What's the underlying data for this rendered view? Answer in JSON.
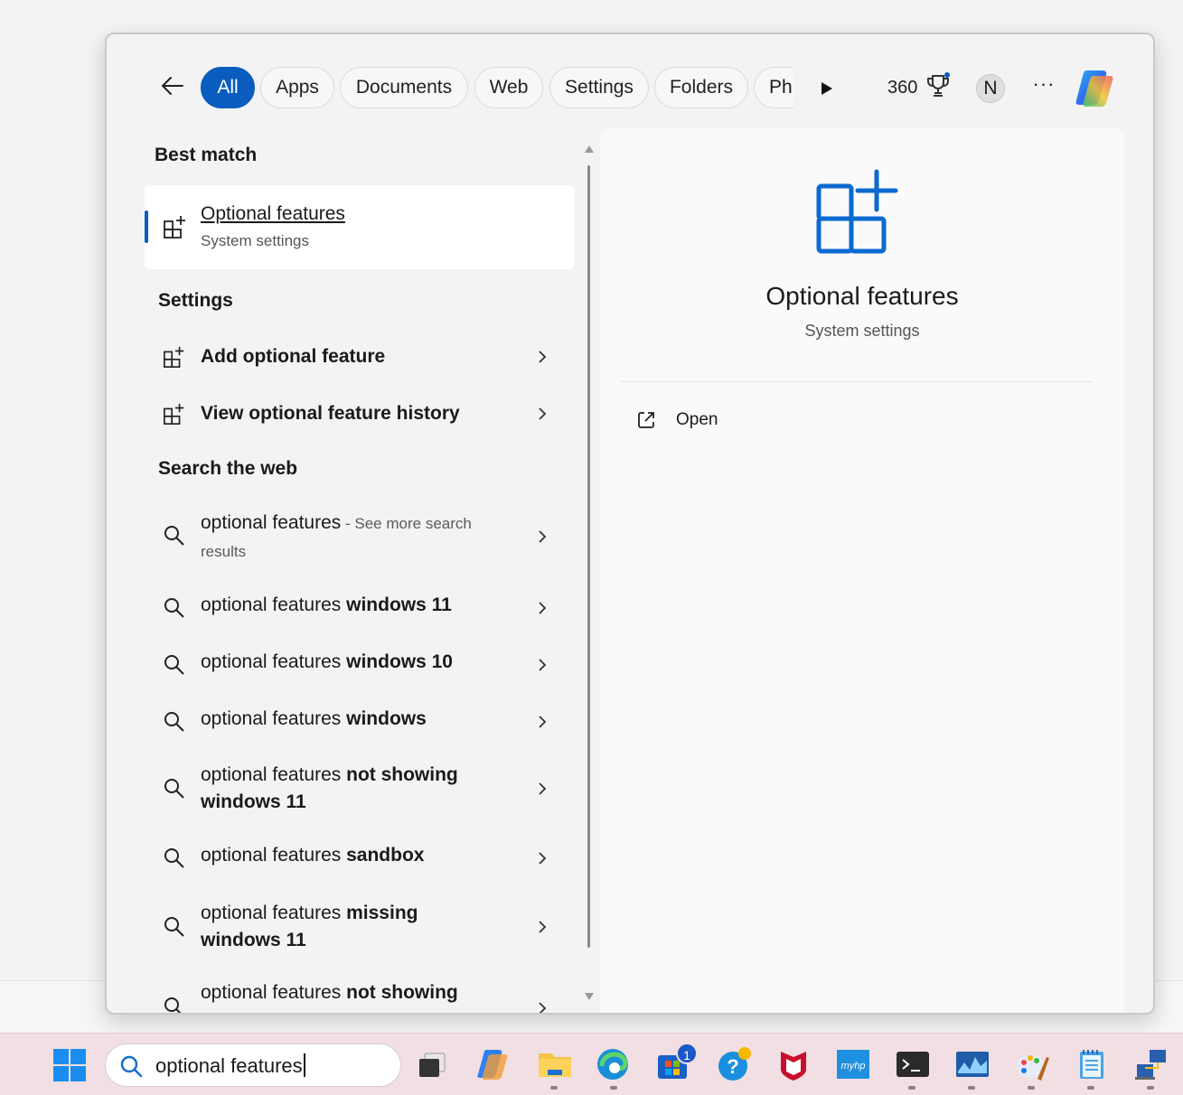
{
  "filters": {
    "back_label": "Back",
    "tabs": [
      {
        "label": "All",
        "active": true
      },
      {
        "label": "Apps"
      },
      {
        "label": "Documents"
      },
      {
        "label": "Web"
      },
      {
        "label": "Settings"
      },
      {
        "label": "Folders"
      },
      {
        "label": "Ph"
      }
    ],
    "points": "360",
    "avatar_initial": "N",
    "more_label": "···"
  },
  "best_match": {
    "heading": "Best match",
    "title": "Optional features",
    "subtitle": "System settings"
  },
  "settings_section": {
    "heading": "Settings",
    "items": [
      {
        "plain": "Add ",
        "bold": "optional",
        "rest": " feature",
        "label": "Add optional feature"
      },
      {
        "plain": "View ",
        "bold": "optional",
        "rest": " feature history",
        "label": "View optional feature history"
      }
    ]
  },
  "web_section": {
    "heading": "Search the web",
    "items": [
      {
        "query": "optional features",
        "suffix": " - See more search results"
      },
      {
        "query": "optional features",
        "bold": " windows 11"
      },
      {
        "query": "optional features",
        "bold": " windows 10"
      },
      {
        "query": "optional features",
        "bold": " windows"
      },
      {
        "query": "optional features",
        "bold": " not showing windows 11"
      },
      {
        "query": "optional features",
        "bold": " sandbox"
      },
      {
        "query": "optional features",
        "bold": " missing windows 11"
      },
      {
        "query": "optional features",
        "bold": " not showing"
      }
    ]
  },
  "detail": {
    "title": "Optional features",
    "subtitle": "System settings",
    "open_label": "Open"
  },
  "taskbar": {
    "search_value": "optional features",
    "store_badge": "1",
    "apps": [
      "task-view-icon",
      "copilot-app-icon",
      "file-explorer-icon",
      "edge-icon",
      "microsoft-store-icon",
      "get-help-icon",
      "mcafee-icon",
      "myhp-icon",
      "terminal-icon",
      "resource-monitor-icon",
      "paint-icon",
      "notepad-icon",
      "network-icon"
    ]
  },
  "colors": {
    "accent": "#0a5cbf",
    "panel_bg": "#f3f3f3",
    "taskbar_bg": "#f1dfe3"
  }
}
